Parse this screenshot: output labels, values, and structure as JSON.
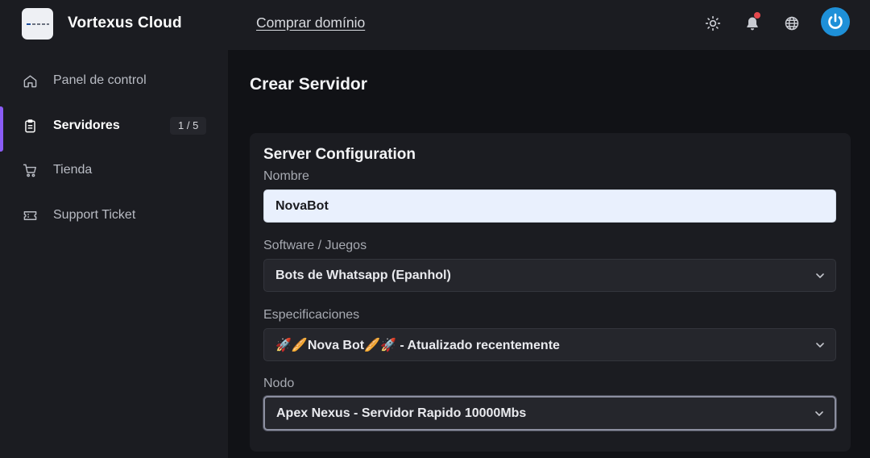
{
  "header": {
    "brand": "Vortexus Cloud",
    "buy_link": "Comprar domínio"
  },
  "sidebar": {
    "items": [
      {
        "label": "Panel de control",
        "icon": "home-icon"
      },
      {
        "label": "Servidores",
        "icon": "clipboard-icon",
        "badge": "1 / 5",
        "active": true
      },
      {
        "label": "Tienda",
        "icon": "cart-icon"
      },
      {
        "label": "Support Ticket",
        "icon": "ticket-icon"
      }
    ]
  },
  "main": {
    "page_title": "Crear Servidor",
    "card_title": "Server Configuration",
    "fields": {
      "name": {
        "label": "Nombre",
        "value": "NovaBot"
      },
      "software": {
        "label": "Software / Juegos",
        "value": "Bots de Whatsapp (Epanhol)"
      },
      "specs": {
        "label": "Especificaciones",
        "value": "🚀🥖Nova Bot🥖🚀 - Atualizado recentemente"
      },
      "node": {
        "label": "Nodo",
        "value": "Apex Nexus - Servidor Rapido 10000Mbs"
      }
    }
  },
  "colors": {
    "accent": "#8b5cf6",
    "notification": "#e5484d",
    "avatar": "#1e90d8"
  }
}
